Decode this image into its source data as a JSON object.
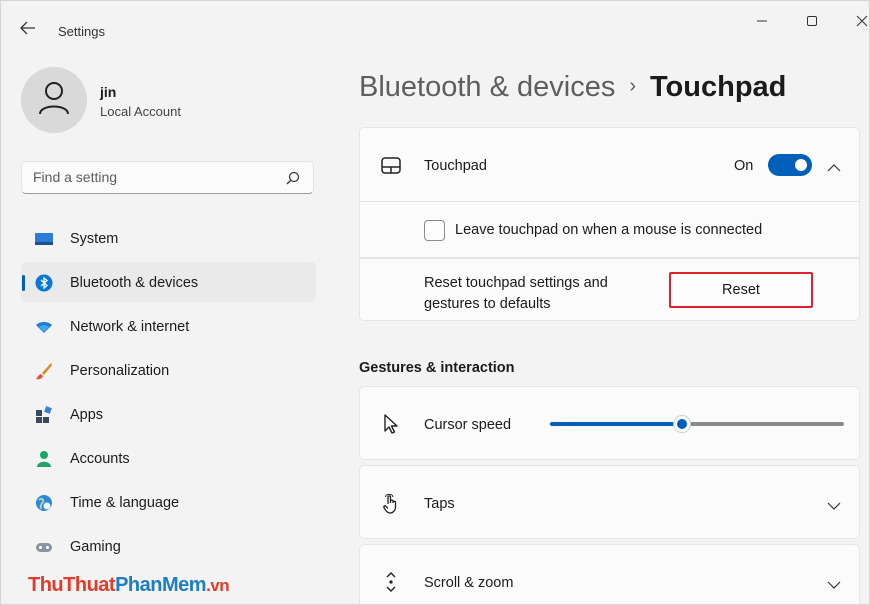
{
  "window": {
    "title": "Settings",
    "controls": [
      "minimize-icon",
      "maximize-icon",
      "close-icon"
    ]
  },
  "user": {
    "name": "jin",
    "account_type": "Local Account"
  },
  "search": {
    "placeholder": "Find a setting"
  },
  "sidebar": {
    "items": [
      {
        "label": "System",
        "icon": "monitor-icon",
        "active": false
      },
      {
        "label": "Bluetooth & devices",
        "icon": "bluetooth-icon",
        "active": true
      },
      {
        "label": "Network & internet",
        "icon": "wifi-icon",
        "active": false
      },
      {
        "label": "Personalization",
        "icon": "brush-icon",
        "active": false
      },
      {
        "label": "Apps",
        "icon": "apps-icon",
        "active": false
      },
      {
        "label": "Accounts",
        "icon": "person-icon",
        "active": false
      },
      {
        "label": "Time & language",
        "icon": "globe-clock-icon",
        "active": false
      },
      {
        "label": "Gaming",
        "icon": "gamepad-icon",
        "active": false
      }
    ]
  },
  "breadcrumb": {
    "parent": "Bluetooth & devices",
    "separator": "›",
    "current": "Touchpad"
  },
  "touchpad": {
    "label": "Touchpad",
    "toggle_state": "On",
    "toggle_on": true,
    "leave_on_label": "Leave touchpad on when a mouse is connected",
    "leave_on_checked": false,
    "reset_description": "Reset touchpad settings and gestures to defaults",
    "reset_button": "Reset"
  },
  "gestures": {
    "section_title": "Gestures & interaction",
    "cursor_speed_label": "Cursor speed",
    "cursor_speed_fraction": 0.45,
    "taps_label": "Taps",
    "scroll_zoom_label": "Scroll & zoom"
  },
  "watermark": {
    "part1": "ThuThuat",
    "part2": "PhanMem",
    "part3": ".vn"
  },
  "colors": {
    "accent": "#005fb8",
    "highlight_border": "#e0202a"
  }
}
